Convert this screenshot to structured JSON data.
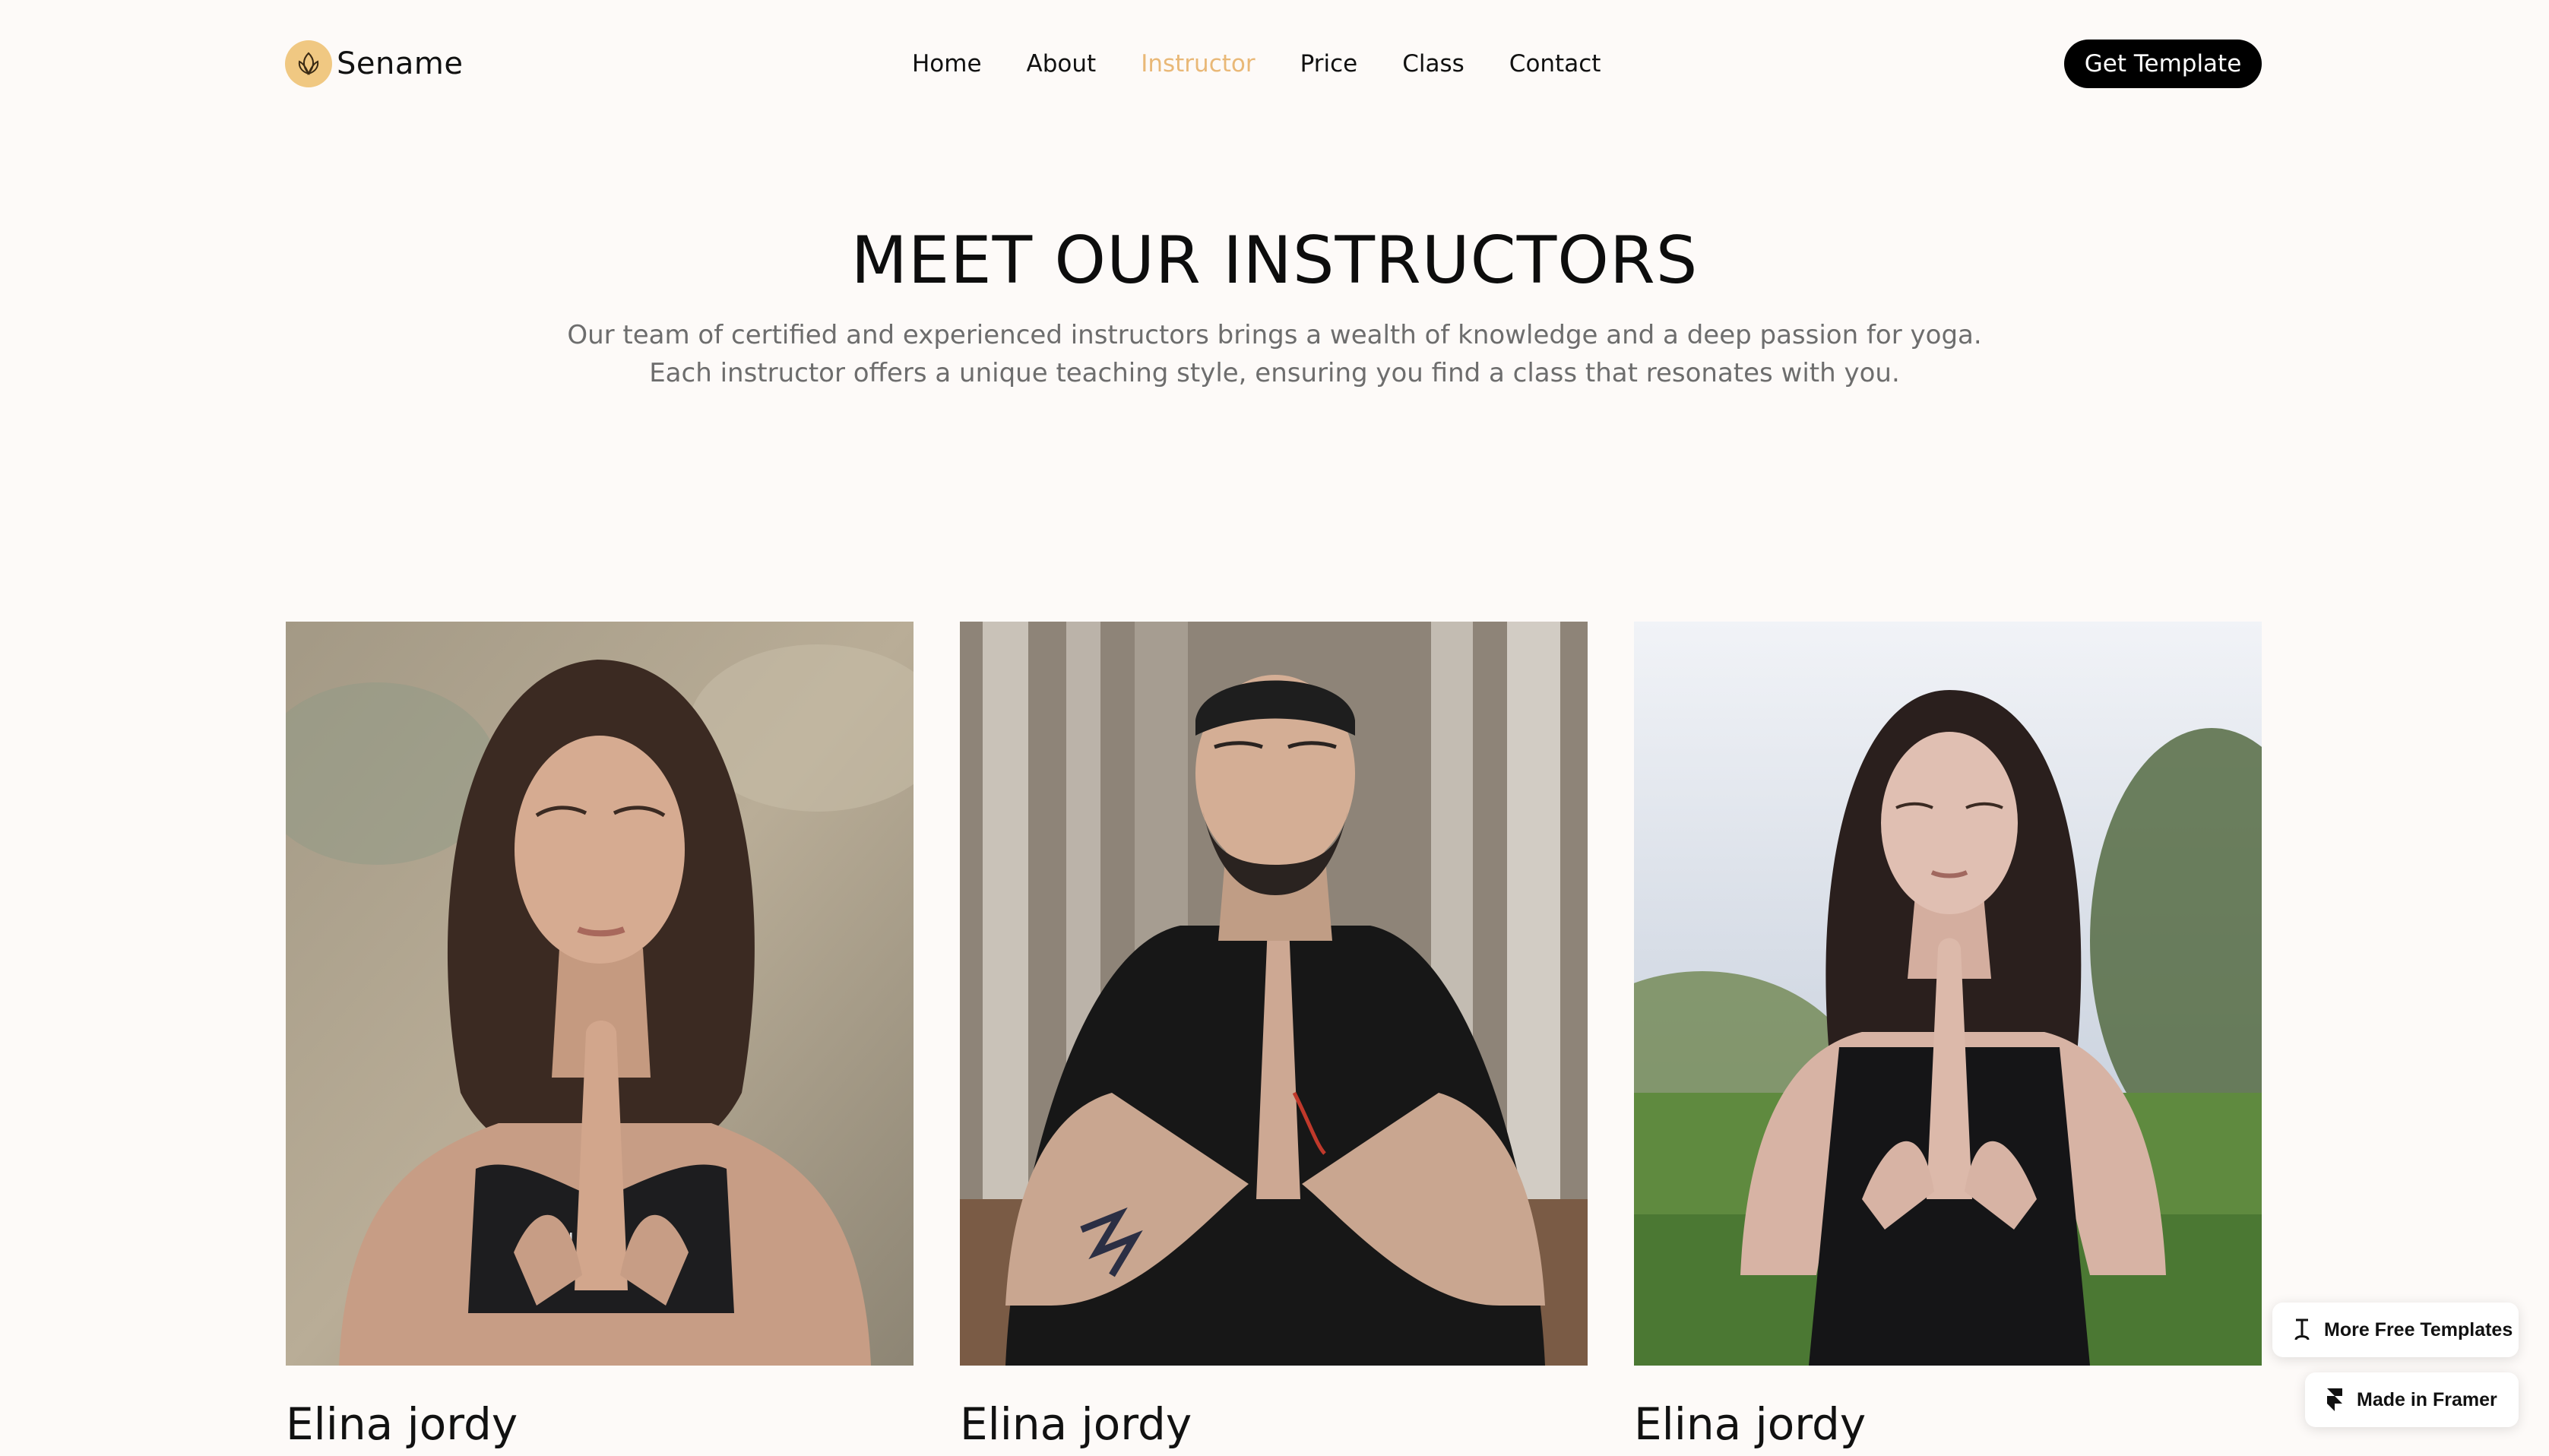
{
  "nav": {
    "brand": "Sename",
    "links": [
      {
        "label": "Home",
        "active": false
      },
      {
        "label": "About",
        "active": false
      },
      {
        "label": "Instructor",
        "active": true
      },
      {
        "label": "Price",
        "active": false
      },
      {
        "label": "Class",
        "active": false
      },
      {
        "label": "Contact",
        "active": false
      }
    ],
    "cta_label": "Get Template"
  },
  "header": {
    "title": "MEET OUR INSTRUCTORS",
    "subtitle": "Our team of certified and experienced instructors brings a wealth of knowledge and a deep passion for yoga. Each instructor offers a unique teaching style, ensuring you find a class that resonates with you."
  },
  "instructors": [
    {
      "name": "Elina jordy"
    },
    {
      "name": "Elina jordy"
    },
    {
      "name": "Elina jordy"
    }
  ],
  "badges": {
    "templates_label": "More Free Templates",
    "framer_label": "Made in Framer"
  },
  "colors": {
    "background": "#fdfaf8",
    "accent": "#e9b877",
    "cta_background": "#000000",
    "subtitle_text": "#6d6d6d"
  },
  "icons": {
    "brand": "lotus-icon",
    "templates": "text-cursor-icon",
    "framer": "framer-logo-icon"
  }
}
